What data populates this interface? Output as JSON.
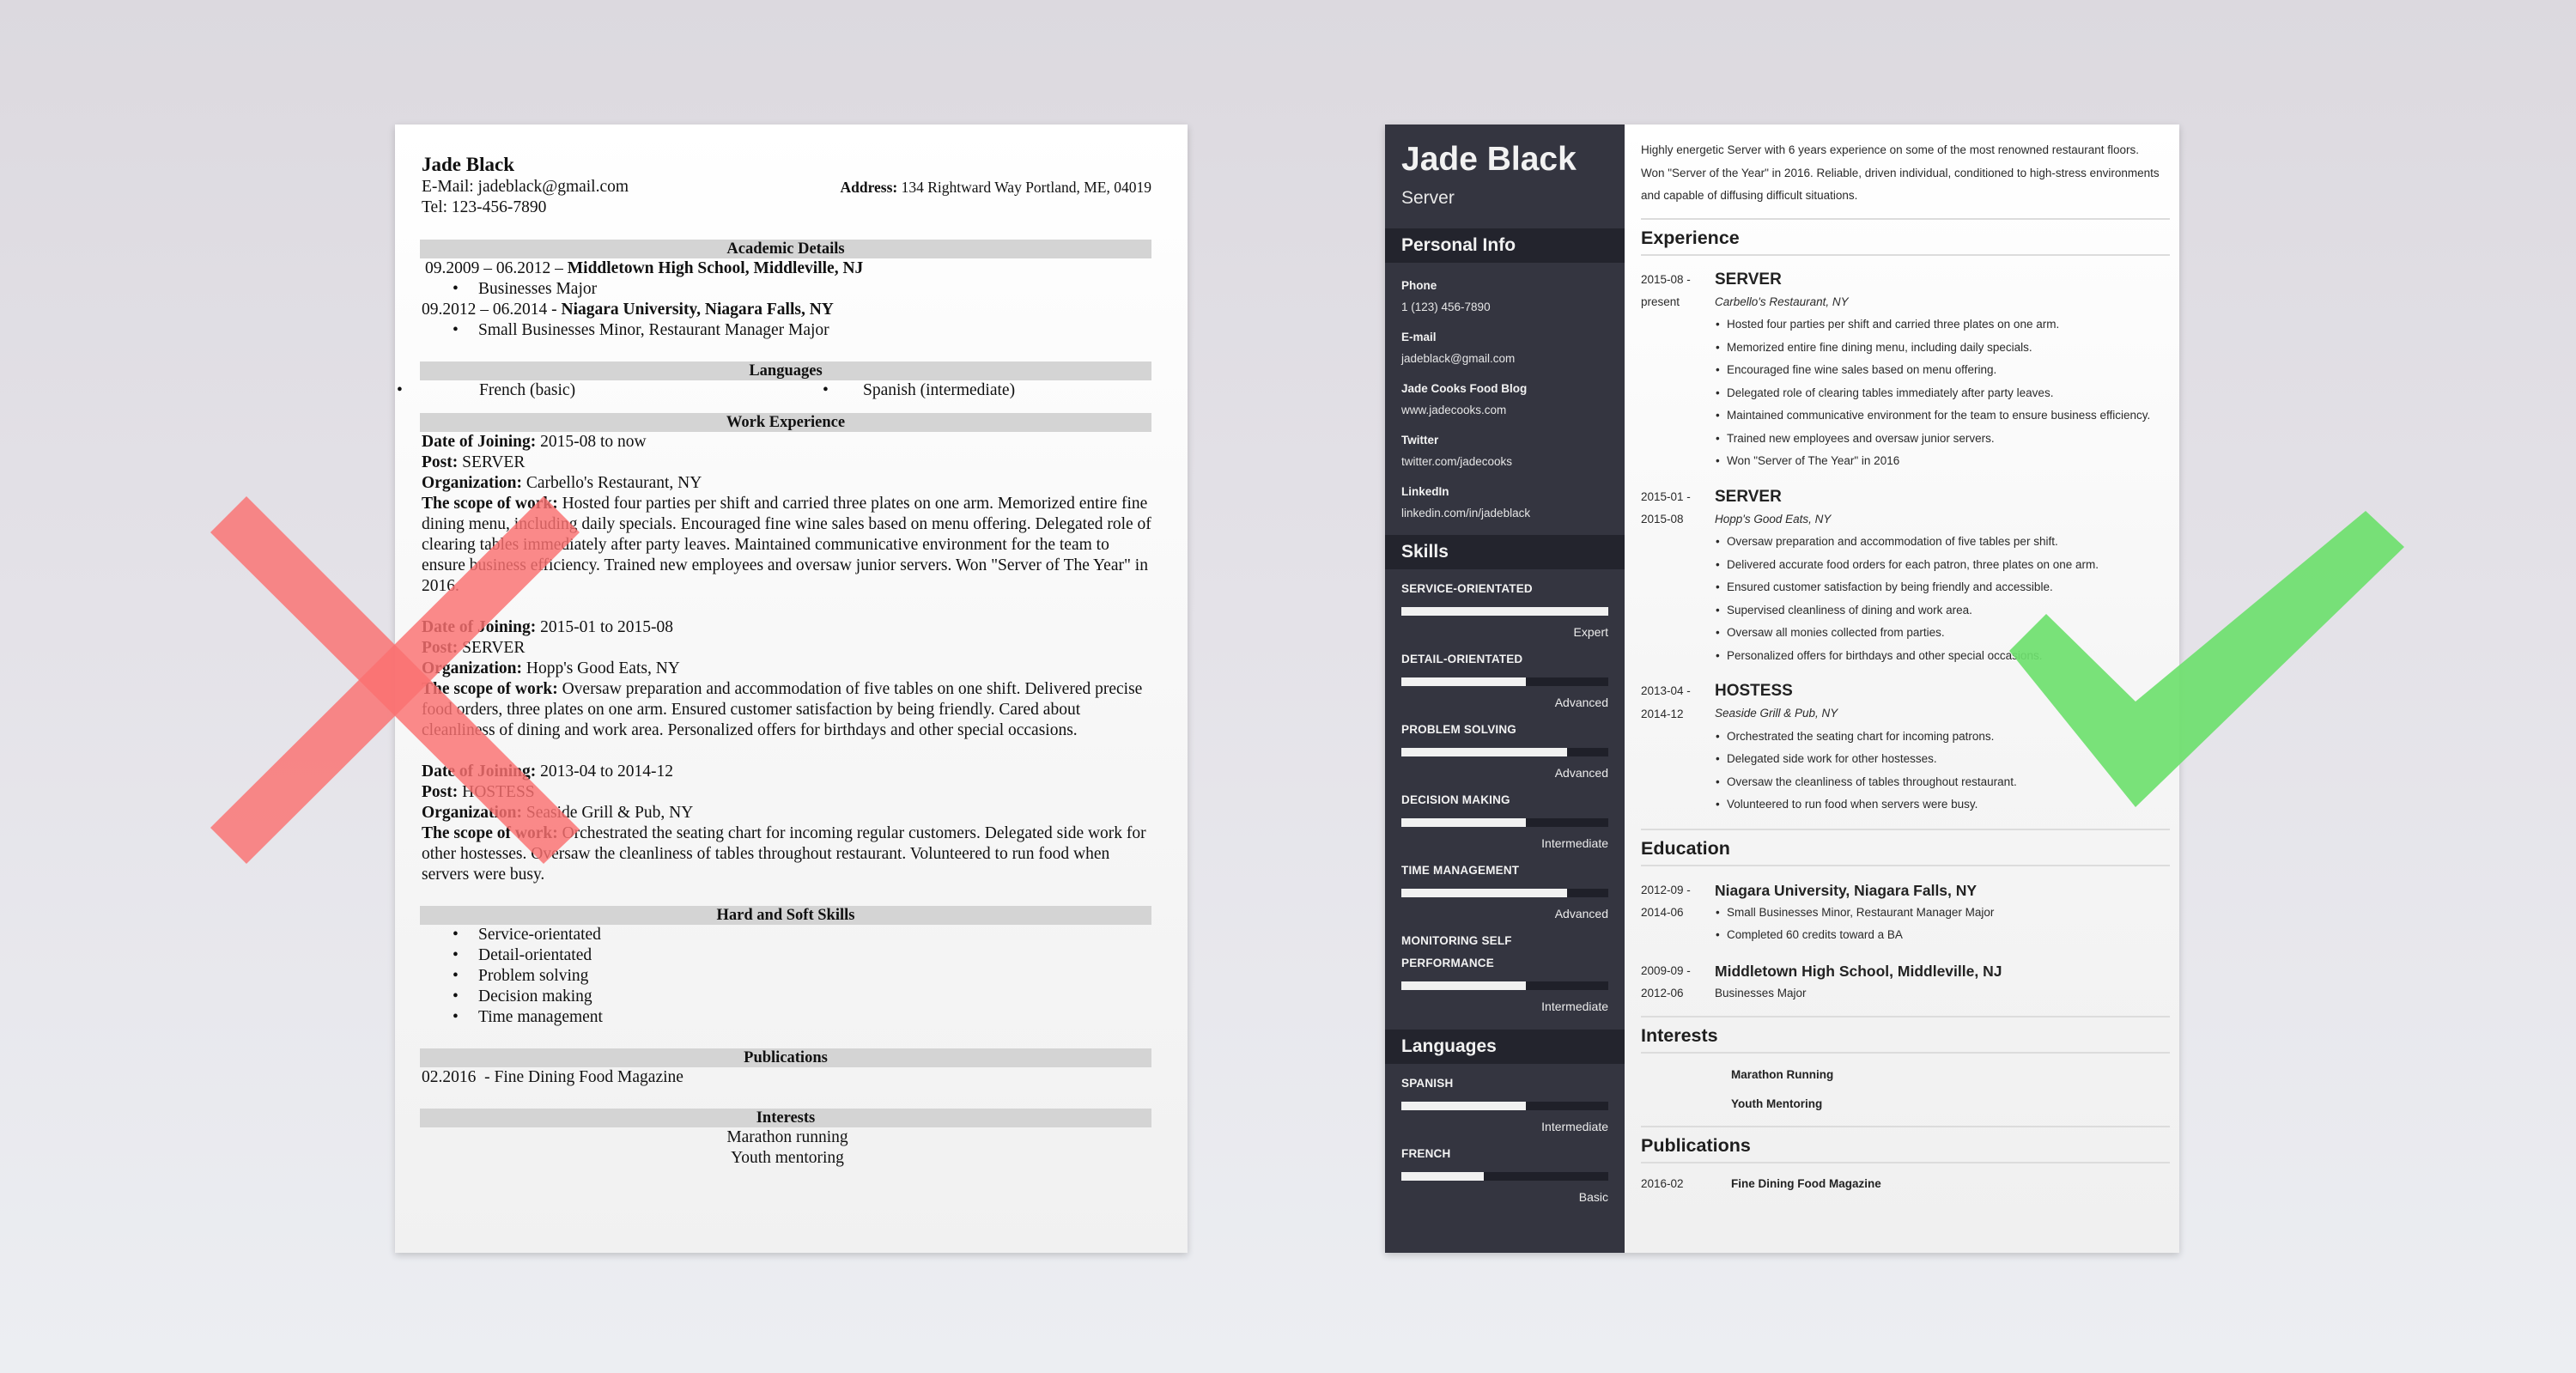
{
  "colors": {
    "background": "#dcd9df",
    "sidebar": "#343540",
    "sidebar_header": "#23242d",
    "bad_mark": "#fa7070",
    "good_mark": "#6ee06e",
    "section_band": "#d4d4d4"
  },
  "bad_resume": {
    "name": "Jade Black",
    "email_line": "E-Mail: jadeblack@gmail.com",
    "tel_line": "Tel: 123-456-7890",
    "address_label": "Address:",
    "address_value": " 134 Rightward Way Portland, ME, 04019",
    "sections": {
      "academic": "Academic Details",
      "languages": "Languages",
      "work": "Work Experience",
      "skills": "Hard and Soft Skills",
      "publications": "Publications",
      "interests": "Interests"
    },
    "education": [
      {
        "dates": "09.2009 – 06.2012 – ",
        "school": "Middletown High School, Middleville, NJ",
        "detail": "Businesses Major"
      },
      {
        "dates": "09.2012 – 06.2014 - ",
        "school": "Niagara University, Niagara Falls, NY",
        "detail": "Small Businesses Minor, Restaurant Manager Major"
      }
    ],
    "languages": [
      "French (basic)",
      "Spanish (intermediate)"
    ],
    "labels": {
      "joining": "Date of Joining:",
      "post": "Post:",
      "org": "Organization:",
      "scope": "The scope of work:"
    },
    "jobs": [
      {
        "joining": " 2015-08 to now",
        "post": " SERVER",
        "org": " Carbello's Restaurant, NY",
        "scope": " Hosted four parties per shift and carried three plates on one arm. Memorized entire fine dining menu, including daily specials. Encouraged fine wine sales based on menu offering. Delegated role of clearing tables immediately after party leaves. Maintained communicative environment for the team to ensure business efficiency. Trained new employees and oversaw junior servers. Won \"Server of The Year\" in 2016."
      },
      {
        "joining": " 2015-01 to 2015-08",
        "post": " SERVER",
        "org": " Hopp's Good Eats, NY",
        "scope": " Oversaw preparation and accommodation of five tables on one shift. Delivered precise food orders, three plates on one arm. Ensured customer satisfaction by being friendly. Cared about cleanliness of dining and work area. Personalized offers for birthdays and other special occasions."
      },
      {
        "joining": " 2013-04 to 2014-12",
        "post": " HOSTESS",
        "org": " Seaside Grill & Pub, NY",
        "scope": " Orchestrated the seating chart for incoming regular customers. Delegated side work for other hostesses. Oversaw the cleanliness of tables throughout restaurant. Volunteered to run food when servers were busy."
      }
    ],
    "skills": [
      "Service-orientated",
      "Detail-orientated",
      "Problem solving",
      "Decision making",
      "Time management"
    ],
    "publication": "02.2016  - Fine Dining Food Magazine",
    "interests": [
      "Marathon running",
      "Youth mentoring"
    ]
  },
  "good_resume": {
    "name": "Jade Black",
    "title": "Server",
    "sidebar": {
      "personal_info_heading": "Personal Info",
      "info": [
        {
          "label": "Phone",
          "value": "1 (123) 456-7890"
        },
        {
          "label": "E-mail",
          "value": "jadeblack@gmail.com"
        },
        {
          "label": "Jade Cooks Food Blog",
          "value": "www.jadecooks.com"
        },
        {
          "label": "Twitter",
          "value": "twitter.com/jadecooks"
        },
        {
          "label": "LinkedIn",
          "value": "linkedin.com/in/jadeblack"
        }
      ],
      "skills_heading": "Skills",
      "skills": [
        {
          "name": "SERVICE-ORIENTATED",
          "level": "Expert",
          "fill": 1.0
        },
        {
          "name": "DETAIL-ORIENTATED",
          "level": "Advanced",
          "fill": 0.6
        },
        {
          "name": "PROBLEM SOLVING",
          "level": "Advanced",
          "fill": 0.8
        },
        {
          "name": "DECISION MAKING",
          "level": "Intermediate",
          "fill": 0.6
        },
        {
          "name": "TIME MANAGEMENT",
          "level": "Advanced",
          "fill": 0.8
        },
        {
          "name": "MONITORING SELF PERFORMANCE",
          "level": "Intermediate",
          "fill": 0.6
        }
      ],
      "languages_heading": "Languages",
      "languages": [
        {
          "name": "SPANISH",
          "level": "Intermediate",
          "fill": 0.6
        },
        {
          "name": "FRENCH",
          "level": "Basic",
          "fill": 0.4
        }
      ]
    },
    "summary": "Highly energetic Server with 6 years experience on some of the most renowned restaurant floors. Won \"Server of the Year\" in 2016. Reliable, driven individual, conditioned to high-stress environments and capable of diffusing difficult situations.",
    "experience_heading": "Experience",
    "experience": [
      {
        "date_start": "2015-08 -",
        "date_end": "present",
        "title": "SERVER",
        "org": "Carbello's Restaurant, NY",
        "bullets": [
          "Hosted four parties per shift and carried three plates on one arm.",
          "Memorized entire fine dining menu, including daily specials.",
          "Encouraged fine wine sales based on menu offering.",
          "Delegated role of clearing tables immediately after party leaves.",
          "Maintained communicative environment for the team to ensure business efficiency.",
          "Trained new employees and oversaw junior servers.",
          "Won \"Server of The Year\" in 2016"
        ]
      },
      {
        "date_start": "2015-01 -",
        "date_end": "2015-08",
        "title": "SERVER",
        "org": "Hopp's Good Eats, NY",
        "bullets": [
          "Oversaw preparation and accommodation of five tables per shift.",
          "Delivered accurate food orders for each patron, three plates on one arm.",
          "Ensured customer satisfaction by being friendly and accessible.",
          "Supervised cleanliness of dining and work area.",
          "Oversaw all monies collected from parties.",
          "Personalized offers for birthdays and other special occasions."
        ]
      },
      {
        "date_start": "2013-04 -",
        "date_end": "2014-12",
        "title": "HOSTESS",
        "org": "Seaside Grill & Pub, NY",
        "bullets": [
          "Orchestrated the seating chart for incoming patrons.",
          "Delegated side work for other hostesses.",
          "Oversaw the cleanliness of tables throughout restaurant.",
          "Volunteered to run food when servers were busy."
        ]
      }
    ],
    "education_heading": "Education",
    "education": [
      {
        "date_start": "2012-09 -",
        "date_end": "2014-06",
        "school": "Niagara University, Niagara Falls, NY",
        "bullets": [
          "Small Businesses Minor, Restaurant Manager Major",
          "Completed 60 credits toward a BA"
        ]
      },
      {
        "date_start": "2009-09 -",
        "date_end": "2012-06",
        "school": "Middletown High School, Middleville, NJ",
        "detail": "Businesses Major"
      }
    ],
    "interests_heading": "Interests",
    "interests": [
      "Marathon Running",
      "Youth Mentoring"
    ],
    "publications_heading": "Publications",
    "publications": [
      {
        "date": "2016-02",
        "title": "Fine Dining Food Magazine"
      }
    ]
  }
}
